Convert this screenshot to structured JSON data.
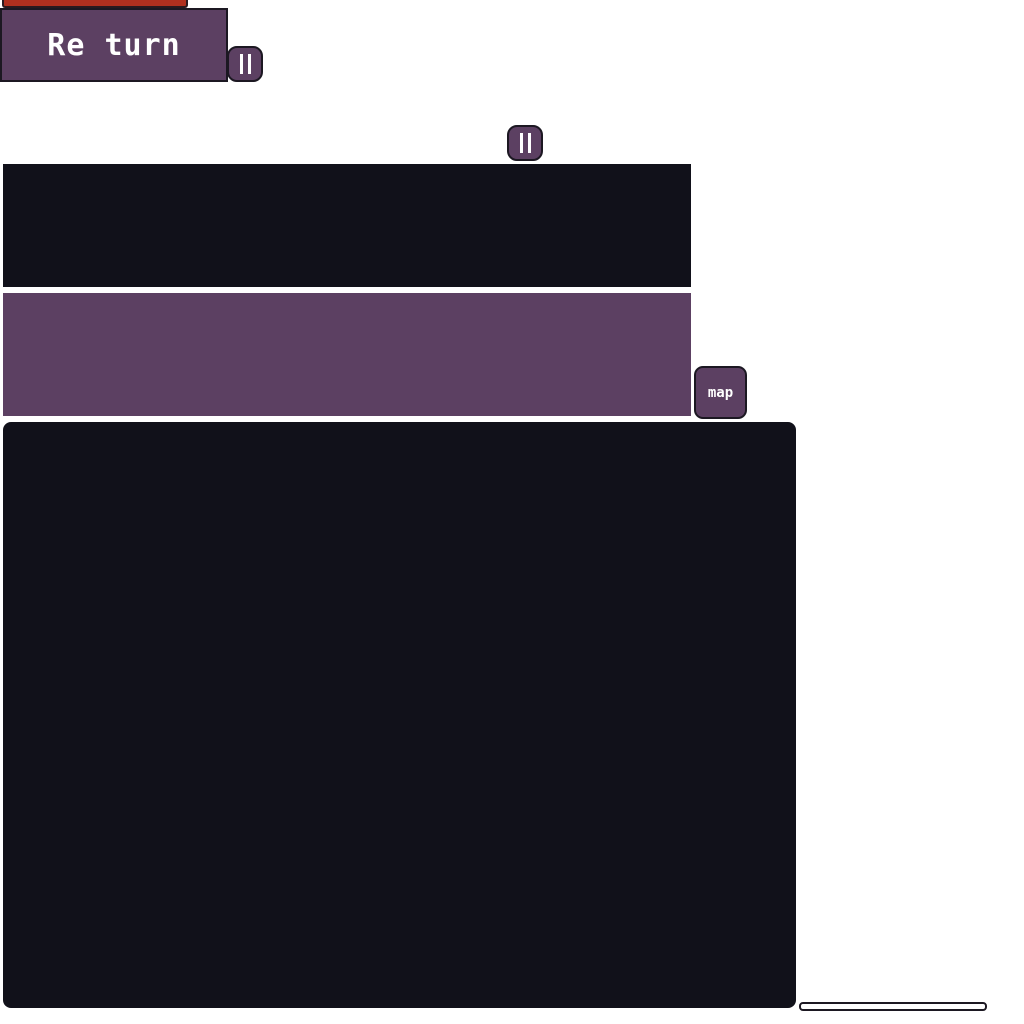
{
  "hud": {
    "return_label": "Re turn",
    "map_label": "map"
  },
  "colors": {
    "panel_purple": "#5c4062",
    "panel_dark": "#11111a",
    "health_red": "#b0301f",
    "outline": "#1c1822"
  },
  "icons": {
    "pause": "pause-icon"
  }
}
